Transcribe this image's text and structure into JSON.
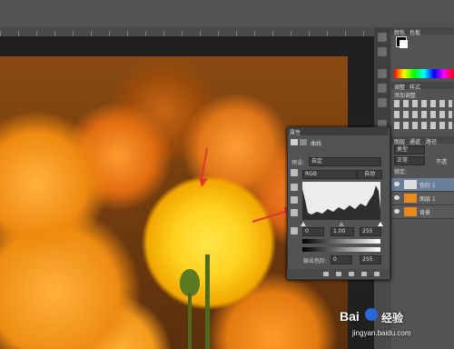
{
  "properties_panel": {
    "title": "属性",
    "tab_label": "曲线",
    "preset_label": "预设:",
    "preset_value": "自定",
    "channel_value": "RGB",
    "auto_button": "自动",
    "input_black": "0",
    "input_gamma": "1.00",
    "input_white": "255",
    "output_label": "输出色阶:",
    "output_black": "0",
    "output_white": "255"
  },
  "right_panels": {
    "color_tab": "颜色",
    "swatch_tab": "色板",
    "adjust_tab": "调整",
    "style_tab": "样式",
    "add_adjust_label": "添加调整",
    "layers_tab": "图层",
    "channels_tab": "通道",
    "paths_tab": "路径",
    "kind_label": "类型",
    "blend_mode": "正常",
    "lock_label": "锁定:",
    "opacity_label": "不透",
    "layers": [
      {
        "name": "色阶 1"
      },
      {
        "name": "图层 1"
      },
      {
        "name": "背景"
      }
    ]
  },
  "watermark": {
    "logo": "Bai",
    "brand_cn": "经验",
    "url": "jingyan.baidu.com"
  },
  "colors": {
    "arrow": "#e0382c",
    "panel_bg": "#535353",
    "histogram_bg": "#ececec"
  }
}
